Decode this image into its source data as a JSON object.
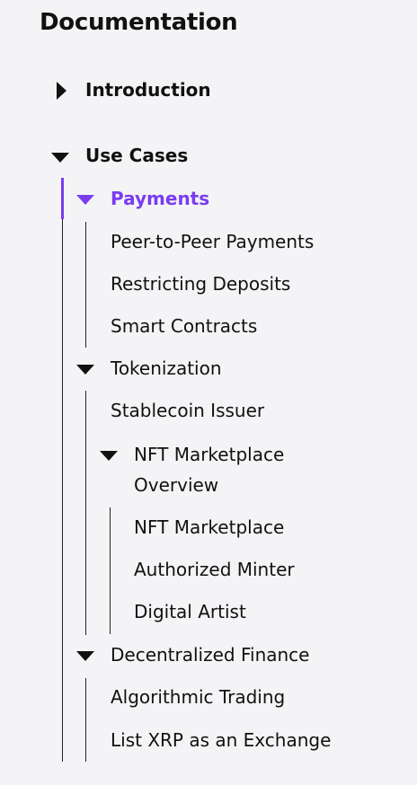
{
  "sidebar": {
    "title": "Documentation",
    "items": {
      "introduction": "Introduction",
      "use_cases": "Use Cases",
      "payments": "Payments",
      "peer_to_peer": "Peer-to-Peer Payments",
      "restricting_deposits": "Restricting Deposits",
      "smart_contracts": "Smart Contracts",
      "tokenization": "Tokenization",
      "stablecoin_issuer": "Stablecoin Issuer",
      "nft_marketplace_overview": "NFT Marketplace Overview",
      "nft_marketplace": "NFT Marketplace",
      "authorized_minter": "Authorized Minter",
      "digital_artist": "Digital Artist",
      "decentralized_finance": "Decentralized Finance",
      "algorithmic_trading": "Algorithmic Trading",
      "list_xrp": "List XRP as an Exchange"
    },
    "colors": {
      "active": "#7a3cf0",
      "text": "#111111",
      "background": "#f4f4f6"
    }
  }
}
